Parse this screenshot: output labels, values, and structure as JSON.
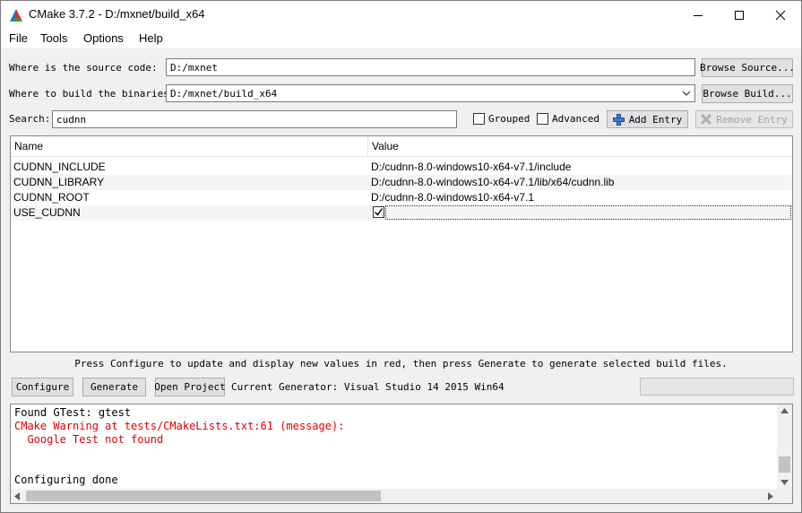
{
  "window": {
    "title": "CMake 3.7.2 - D:/mxnet/build_x64"
  },
  "menu": [
    "File",
    "Tools",
    "Options",
    "Help"
  ],
  "source": {
    "label": "Where is the source code:",
    "value": "D:/mxnet",
    "browse_label": "Browse Source..."
  },
  "build": {
    "label": "Where to build the binaries:",
    "value": "D:/mxnet/build_x64",
    "browse_label": "Browse Build..."
  },
  "search": {
    "label": "Search:",
    "value": "cudnn"
  },
  "options": {
    "grouped": "Grouped",
    "advanced": "Advanced",
    "grouped_checked": false,
    "advanced_checked": false
  },
  "entry_buttons": {
    "add": "Add Entry",
    "remove": "Remove Entry"
  },
  "table": {
    "headers": {
      "name": "Name",
      "value": "Value"
    },
    "rows": [
      {
        "name": "CUDNN_INCLUDE",
        "value": "D:/cudnn-8.0-windows10-x64-v7.1/include"
      },
      {
        "name": "CUDNN_LIBRARY",
        "value": "D:/cudnn-8.0-windows10-x64-v7.1/lib/x64/cudnn.lib"
      },
      {
        "name": "CUDNN_ROOT",
        "value": "D:/cudnn-8.0-windows10-x64-v7.1"
      },
      {
        "name": "USE_CUDNN",
        "value": "",
        "checked": true
      }
    ]
  },
  "hint": "Press Configure to update and display new values in red, then press Generate to generate selected build files.",
  "actions": {
    "configure": "Configure",
    "generate": "Generate",
    "open_project": "Open Project",
    "generator": "Current Generator: Visual Studio 14 2015 Win64"
  },
  "output": {
    "lines": [
      {
        "text": "Found GTest: gtest",
        "color": "#000000"
      },
      {
        "text": "CMake Warning at tests/CMakeLists.txt:61 (message):",
        "color": "#e00000"
      },
      {
        "text": "  Google Test not found",
        "color": "#e00000"
      },
      {
        "text": "",
        "color": "#000000"
      },
      {
        "text": "",
        "color": "#000000"
      },
      {
        "text": "Configuring done",
        "color": "#000000"
      }
    ]
  }
}
